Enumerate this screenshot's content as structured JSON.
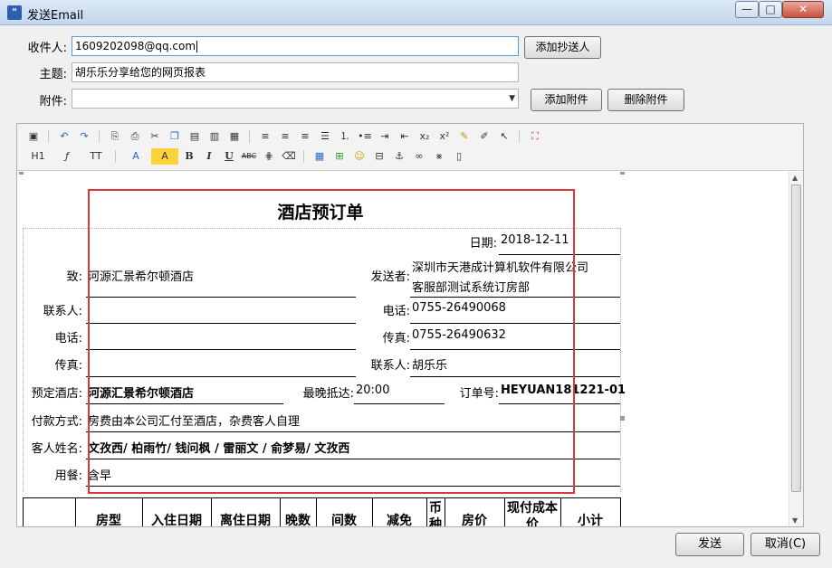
{
  "window": {
    "title": "发送Email",
    "min": "—",
    "max": "□",
    "close": "✕"
  },
  "form": {
    "to_label": "收件人:",
    "to_value": "1609202098@qq.com",
    "add_cc_button": "添加抄送人",
    "subject_label": "主题:",
    "subject_value": "胡乐乐分享给您的网页报表",
    "attach_label": "附件:",
    "attach_value": "",
    "add_attach_button": "添加附件",
    "remove_attach_button": "删除附件"
  },
  "toolbar": {
    "row1": [
      "insert-image-icon",
      "undo-icon",
      "redo-icon",
      "preview-icon",
      "print-icon",
      "cut-icon",
      "copy-icon",
      "paste-icon",
      "paste-text-icon",
      "paste-word-icon",
      "align-left-icon",
      "align-center-icon",
      "align-right-icon",
      "justify-icon",
      "ordered-list-icon",
      "unordered-list-icon",
      "indent-icon",
      "outdent-icon",
      "subscript-icon",
      "superscript-icon",
      "clear-format-icon",
      "select-all-icon",
      "select-icon",
      "fullscreen-icon"
    ],
    "h1": "H1",
    "font": "ƒ",
    "size": "TT",
    "fontcolor": "A",
    "highlight": "A",
    "bold": "B",
    "italic": "I",
    "underline": "U",
    "strike": "ABC"
  },
  "document": {
    "title": "酒店预订单",
    "date_label": "日期:",
    "date_value": "2018-12-11",
    "to_label": "致:",
    "to_value": "河源汇景希尔顿酒店",
    "sender_label": "发送者:",
    "sender_value_1": "深圳市天港成计算机软件有限公司",
    "sender_value_2": "客服部测试系统订房部",
    "contact_label": "联系人:",
    "contact_value": "",
    "phone_label_r": "电话:",
    "phone_value_r": "0755-26490068",
    "phone_label": "电话:",
    "fax_label_r": "传真:",
    "fax_value_r": "0755-26490632",
    "fax_label": "传真:",
    "contact_label_r": "联系人:",
    "contact_value_r": "胡乐乐",
    "hotel_label": "预定酒店:",
    "hotel_value": "河源汇景希尔顿酒店",
    "latest_label": "最晚抵达:",
    "latest_value": "20:00",
    "order_label": "订单号:",
    "order_value": "HEYUAN181221-01",
    "payment_label": "付款方式:",
    "payment_value": "房费由本公司汇付至酒店，杂费客人自理",
    "guest_label": "客人姓名:",
    "guest_value": "文孜西/ 柏雨竹/ 钱问枫 / 雷丽文 / 俞梦易/ 文孜西",
    "meal_label": "用餐:",
    "meal_value": "含早",
    "table_headers": [
      "房型",
      "入住日期",
      "离住日期",
      "晚数",
      "间数",
      "减免",
      "币种",
      "房价",
      "现付成本价",
      "小计"
    ]
  },
  "footer": {
    "send_button": "发送",
    "cancel_button": "取消(C)"
  }
}
